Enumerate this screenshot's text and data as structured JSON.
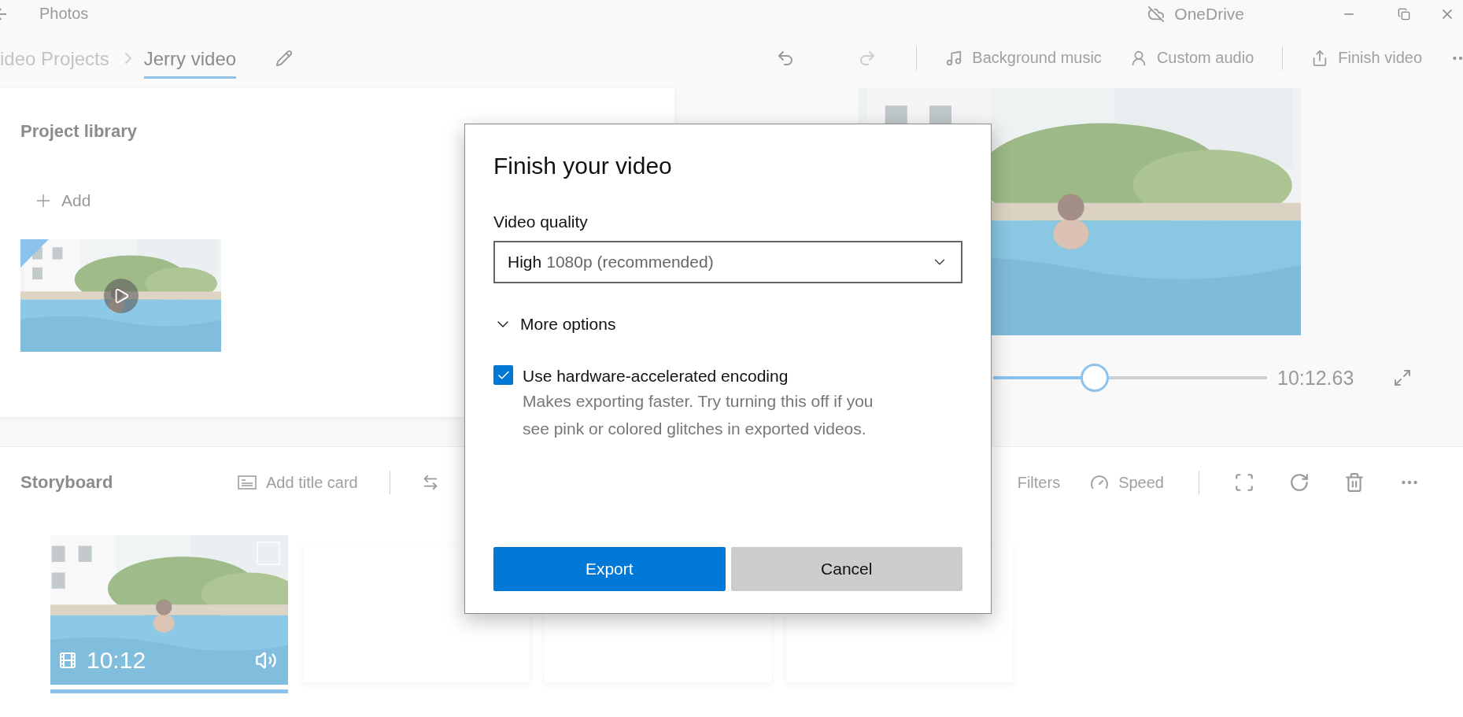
{
  "window": {
    "title": "Photos",
    "cloud": "OneDrive"
  },
  "breadcrumb": [
    {
      "label": "ideo Projects",
      "selected": false
    },
    {
      "label": "Jerry video",
      "selected": true
    }
  ],
  "toolbar": [
    {
      "label": "Background music",
      "kind": "music"
    },
    {
      "label": "Custom audio",
      "kind": "audio"
    },
    {
      "label": "Finish video",
      "kind": "finish"
    }
  ],
  "library": {
    "title": "Project library",
    "add": "Add"
  },
  "player": {
    "level": 0.37,
    "time": "10:12.63"
  },
  "storyboard": {
    "title": "Storyboard",
    "actions": [
      {
        "label": "Add title card",
        "kind": "title_card"
      },
      {
        "label": "Filters",
        "kind": "filters"
      },
      {
        "label": "Speed",
        "kind": "speed"
      }
    ],
    "clips": [
      {
        "kind": "video",
        "duration": "10:12",
        "selected": true
      },
      {
        "kind": "empty",
        "selected": false
      },
      {
        "kind": "empty",
        "selected": false
      },
      {
        "kind": "empty",
        "selected": false
      }
    ]
  },
  "dialog": {
    "title": "Finish your video",
    "quality_label": "Video quality",
    "quality": {
      "value": "High",
      "detail": "1080p (recommended)"
    },
    "more_options": {
      "label": "More options",
      "expanded": true
    },
    "checkbox": {
      "label": "Use hardware-accelerated encoding",
      "checked": true,
      "description": "Makes exporting faster. Try turning this off if you see pink or colored glitches in exported videos."
    },
    "buttons": [
      {
        "label": "Export",
        "kind": "primary"
      },
      {
        "label": "Cancel",
        "kind": "secondary"
      }
    ]
  }
}
